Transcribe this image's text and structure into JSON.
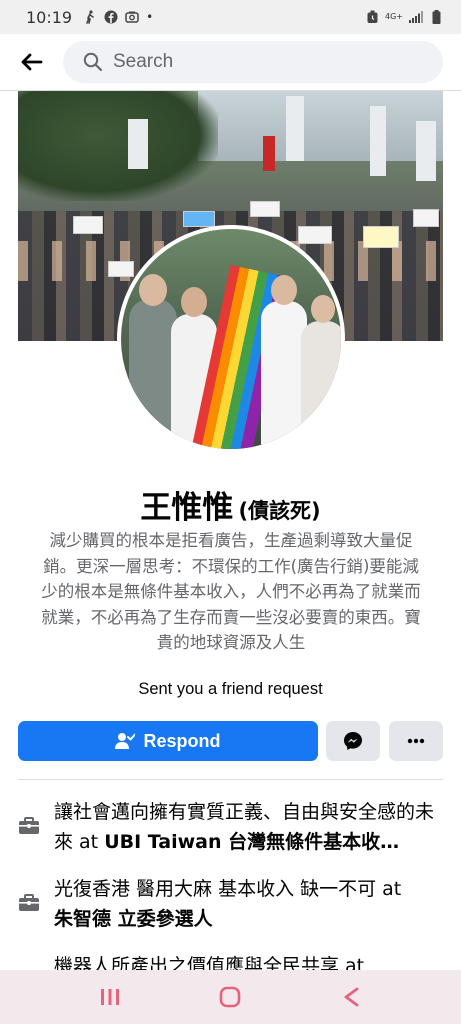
{
  "status_bar": {
    "time": "10:19",
    "network": "4G+",
    "dot": "•",
    "icons": [
      "walk-icon",
      "facebook-notif-icon",
      "camera-notif-icon",
      "alarm-icon",
      "signal-icon",
      "battery-icon"
    ]
  },
  "header": {
    "search_placeholder": "Search"
  },
  "profile": {
    "name": "王惟惟",
    "alternate_name": "(債該死)",
    "bio": "減少購買的根本是拒看廣告，生產過剩導致大量促銷。更深一層思考：不環保的工作(廣告行銷)要能減少的根本是無條件基本收入，人們不必再為了就業而就業，不必再為了生存而賣一些沒必要賣的東西。寶貴的地球資源及人生",
    "friend_request_text": "Sent you a friend request"
  },
  "actions": {
    "respond_label": "Respond",
    "respond_color": "#1877f2",
    "messenger_icon": "messenger-icon",
    "more_icon": "more-dots-icon"
  },
  "work": [
    {
      "prefix": "讓社會邁向擁有實質正義、自由與安全感的未來 at ",
      "org": "UBI Taiwan 台灣無條件基本收…"
    },
    {
      "prefix": "光復香港 醫用大麻 基本收入 缺一不可 at ",
      "org": "朱智德 立委參選人"
    },
    {
      "prefix": "機器人所產出之價值應與全民共享 at",
      "org": ""
    }
  ],
  "nav": {
    "icons": [
      "recent-apps-icon",
      "home-icon",
      "back-nav-icon"
    ],
    "accent": "#e6637f"
  }
}
